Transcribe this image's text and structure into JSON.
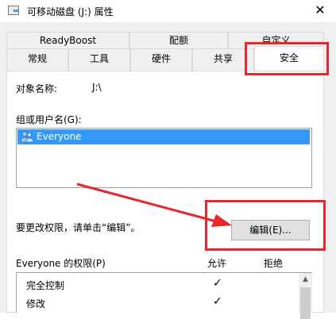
{
  "window": {
    "title": "可移动磁盘 (J:) 属性",
    "close_glyph": "✕"
  },
  "tabs_row1": [
    {
      "label": "ReadyBoost"
    },
    {
      "label": "配额"
    },
    {
      "label": "自定义"
    }
  ],
  "tabs_row2": [
    {
      "label": "常规"
    },
    {
      "label": "工具"
    },
    {
      "label": "硬件"
    },
    {
      "label": "共享"
    },
    {
      "label": "安全"
    }
  ],
  "object": {
    "label": "对象名称:",
    "value": "J:\\"
  },
  "groups": {
    "label": "组或用户名(G):",
    "items": [
      {
        "name": "Everyone"
      }
    ]
  },
  "change_hint": "要更改权限，请单击“编辑”。",
  "edit_button": "编辑(E)...",
  "permissions": {
    "title": "Everyone 的权限(P)",
    "allow_header": "允许",
    "deny_header": "拒绝",
    "rows": [
      {
        "name": "完全控制",
        "allow": "✓",
        "deny": ""
      },
      {
        "name": "修改",
        "allow": "✓",
        "deny": ""
      }
    ]
  },
  "colors": {
    "accent": "#3399ff",
    "annotation": "#e8262b"
  }
}
